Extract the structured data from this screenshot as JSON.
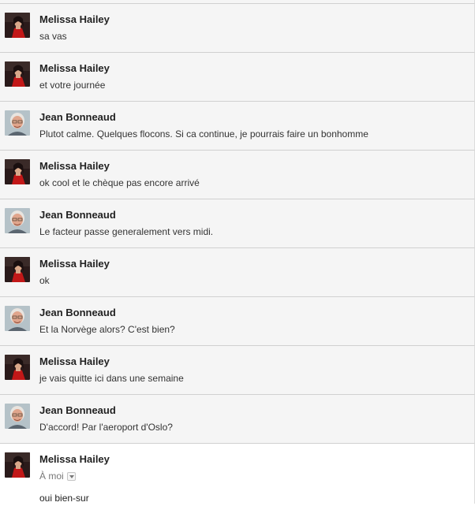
{
  "messages": [
    {
      "sender": "Melissa Hailey",
      "snippet": "sa vas",
      "avatar": "melissa"
    },
    {
      "sender": "Melissa Hailey",
      "snippet": "et votre journée",
      "avatar": "melissa"
    },
    {
      "sender": "Jean Bonneaud",
      "snippet": "Plutot calme. Quelques flocons. Si ca continue, je pourrais faire un bonhomme",
      "avatar": "jean"
    },
    {
      "sender": "Melissa Hailey",
      "snippet": "ok cool et le chèque pas encore arrivé",
      "avatar": "melissa"
    },
    {
      "sender": "Jean Bonneaud",
      "snippet": "Le facteur passe generalement vers midi.",
      "avatar": "jean"
    },
    {
      "sender": "Melissa Hailey",
      "snippet": "ok",
      "avatar": "melissa"
    },
    {
      "sender": "Jean Bonneaud",
      "snippet": "Et la Norvège alors? C'est bien?",
      "avatar": "jean"
    },
    {
      "sender": "Melissa Hailey",
      "snippet": "je vais quitte ici dans une semaine",
      "avatar": "melissa"
    },
    {
      "sender": "Jean Bonneaud",
      "snippet": "D'accord! Par l'aeroport d'Oslo?",
      "avatar": "jean"
    }
  ],
  "open_message": {
    "sender": "Melissa Hailey",
    "recipient": "À moi",
    "body": "oui bien-sur",
    "avatar": "melissa"
  },
  "colors": {
    "collapsed_bg": "#f5f5f5",
    "divider": "#d0d0d0",
    "sender_text": "#222222",
    "recipient_text": "#777777"
  }
}
